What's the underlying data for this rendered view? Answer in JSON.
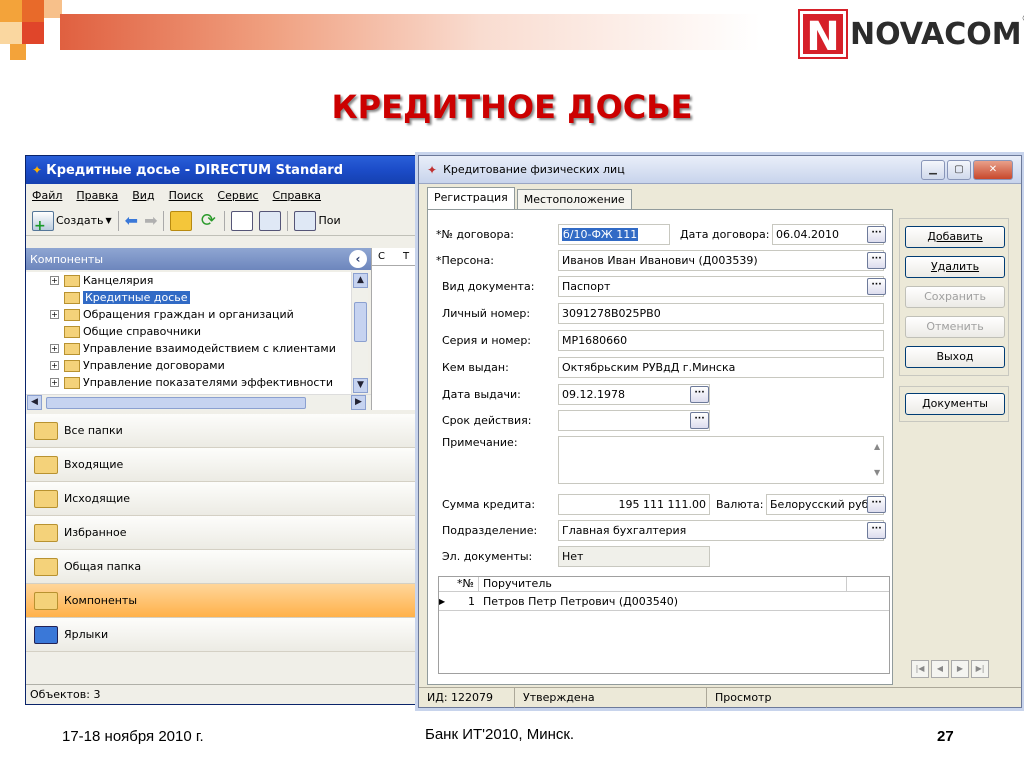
{
  "slide": {
    "title": "КРЕДИТНОЕ ДОСЬЕ",
    "footer_date": "17-18 ноября 2010 г.",
    "footer_center": "Банк ИТ'2010, Минск.",
    "page_number": "27",
    "logo_letter": "N",
    "logo_text": "NOVACOM",
    "logo_mark": "®",
    "colors": {
      "title": "#cc0000",
      "logo": "#d62029"
    }
  },
  "main_window": {
    "title": "Кредитные досье - DIRECTUM Standard",
    "menu": [
      "Файл",
      "Правка",
      "Вид",
      "Поиск",
      "Сервис",
      "Справка"
    ],
    "toolbar": {
      "create_label": "Создать",
      "create_arrow": "▼",
      "search_partial": "Пои"
    },
    "panel_title": "Компоненты",
    "tree": [
      {
        "label": "Канцелярия",
        "expand": "+"
      },
      {
        "label": "Кредитные досье",
        "expand": ""
      },
      {
        "label": "Обращения граждан и организаций",
        "expand": "+"
      },
      {
        "label": "Общие справочники",
        "expand": ""
      },
      {
        "label": "Управление взаимодействием с клиентами",
        "expand": "+"
      },
      {
        "label": "Управление договорами",
        "expand": "+"
      },
      {
        "label": "Управление показателями эффективности",
        "expand": "+"
      }
    ],
    "strip_columns": [
      "С",
      "Т"
    ],
    "nav": [
      "Все папки",
      "Входящие",
      "Исходящие",
      "Избранное",
      "Общая папка",
      "Компоненты",
      "Ярлыки"
    ],
    "status": "Объектов: 3"
  },
  "dialog": {
    "title": "Кредитование физических лиц",
    "tabs": [
      "Регистрация",
      "Местоположение"
    ],
    "fields": {
      "contract_no_label": "*№ договора:",
      "contract_no": "б/10-ФЖ 111",
      "contract_date_label": "Дата договора:",
      "contract_date": "06.04.2010",
      "person_label": "*Персона:",
      "person": "Иванов Иван Иванович (Д003539)",
      "doc_type_label": "Вид документа:",
      "doc_type": "Паспорт",
      "personal_no_label": "Личный номер:",
      "personal_no": "3091278B025PB0",
      "series_label": "Серия и номер:",
      "series": "MP1680660",
      "issued_by_label": "Кем выдан:",
      "issued_by": "Октябрьским РУВдД г.Минска",
      "issue_date_label": "Дата выдачи:",
      "issue_date": "09.12.1978",
      "validity_label": "Срок действия:",
      "validity": "",
      "note_label": "Примечание:",
      "note": "",
      "amount_label": "Сумма кредита:",
      "amount": "195 111 111.00",
      "currency_label": "Валюта:",
      "currency": "Белорусский рубл",
      "division_label": "Подразделение:",
      "division": "Главная бухгалтерия",
      "edocs_label": "Эл. документы:",
      "edocs": "Нет"
    },
    "grid": {
      "columns": [
        "*№",
        "Поручитель"
      ],
      "rows": [
        {
          "no": "1",
          "guarantor": "Петров Петр Петрович (Д003540)"
        }
      ]
    },
    "buttons": {
      "add": "Добавить",
      "delete": "Удалить",
      "save": "Сохранить",
      "cancel": "Отменить",
      "exit": "Выход",
      "documents": "Документы"
    },
    "status": {
      "id": "ИД: 122079",
      "state": "Утверждена",
      "mode": "Просмотр"
    }
  }
}
